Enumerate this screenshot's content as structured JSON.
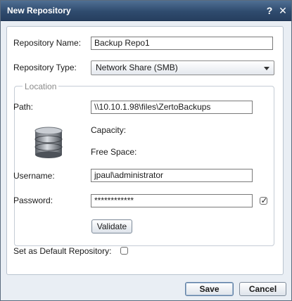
{
  "dialog": {
    "title": "New Repository",
    "help_icon": "help-icon",
    "close_icon": "close-icon"
  },
  "form": {
    "repository_name_label": "Repository Name:",
    "repository_name_value": "Backup Repo1",
    "repository_type_label": "Repository Type:",
    "repository_type_value": "Network Share (SMB)",
    "location_legend": "Location",
    "path_label": "Path:",
    "path_value": "\\\\10.10.1.98\\files\\ZertoBackups",
    "capacity_label": "Capacity:",
    "free_space_label": "Free Space:",
    "storage_icon": "database-icon",
    "username_label": "Username:",
    "username_value": "jpaul\\administrator",
    "password_label": "Password:",
    "password_value": "************",
    "password_checkbox_checked": true,
    "validate_label": "Validate",
    "default_repo_label": "Set as Default Repository:",
    "default_repo_checked": false
  },
  "footer": {
    "save_label": "Save",
    "cancel_label": "Cancel"
  }
}
